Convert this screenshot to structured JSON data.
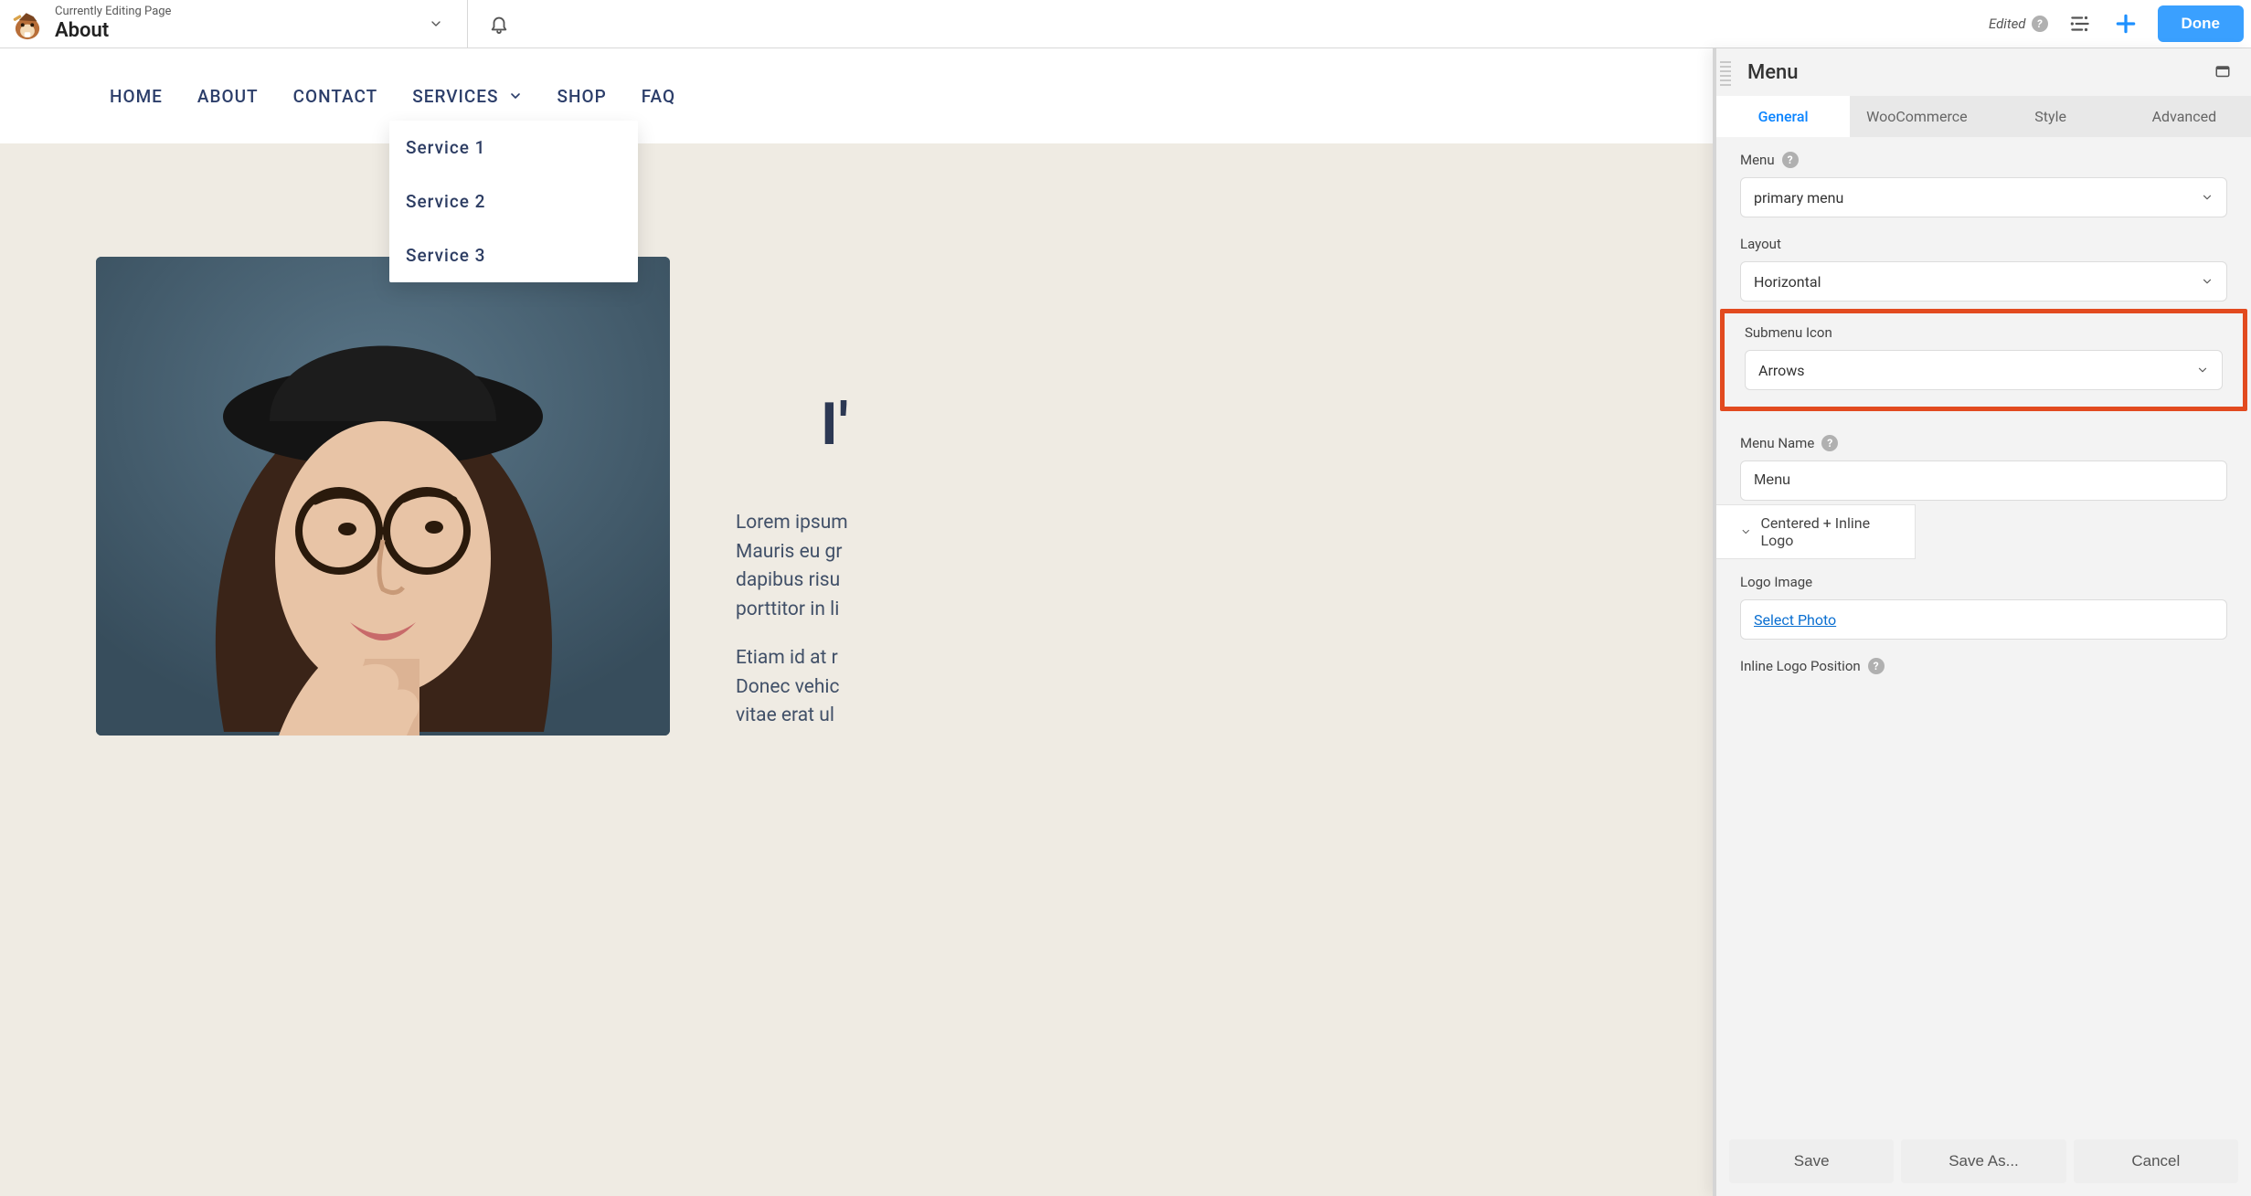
{
  "topbar": {
    "subtitle": "Currently Editing Page",
    "title": "About",
    "edited_label": "Edited",
    "done_label": "Done"
  },
  "site_nav": {
    "items": [
      "HOME",
      "ABOUT",
      "CONTACT",
      "SERVICES",
      "SHOP",
      "FAQ"
    ],
    "submenu": [
      "Service 1",
      "Service 2",
      "Service 3"
    ]
  },
  "page": {
    "heading_fragment": "I'",
    "para1_l1": "Lorem ipsum",
    "para1_l2": "Mauris eu gr",
    "para1_l3": "dapibus risu",
    "para1_l4": "porttitor in li",
    "para2_l1": "Etiam id at r",
    "para2_l2": "Donec vehic",
    "para2_l3": "vitae erat ul"
  },
  "panel": {
    "title": "Menu",
    "tabs": [
      "General",
      "WooCommerce",
      "Style",
      "Advanced"
    ],
    "active_tab": 0,
    "fields": {
      "menu_label": "Menu",
      "menu_value": "primary menu",
      "layout_label": "Layout",
      "layout_value": "Horizontal",
      "submenu_icon_label": "Submenu Icon",
      "submenu_icon_value": "Arrows",
      "menu_name_label": "Menu Name",
      "menu_name_value": "Menu",
      "section_toggle": "Centered + Inline Logo",
      "logo_image_label": "Logo Image",
      "select_photo": "Select Photo",
      "inline_logo_position_label": "Inline Logo Position"
    },
    "footer": {
      "save": "Save",
      "save_as": "Save As...",
      "cancel": "Cancel"
    }
  },
  "colors": {
    "accent": "#3aa0ff",
    "highlight": "#e24a1f",
    "nav_text": "#2c3e6a"
  }
}
